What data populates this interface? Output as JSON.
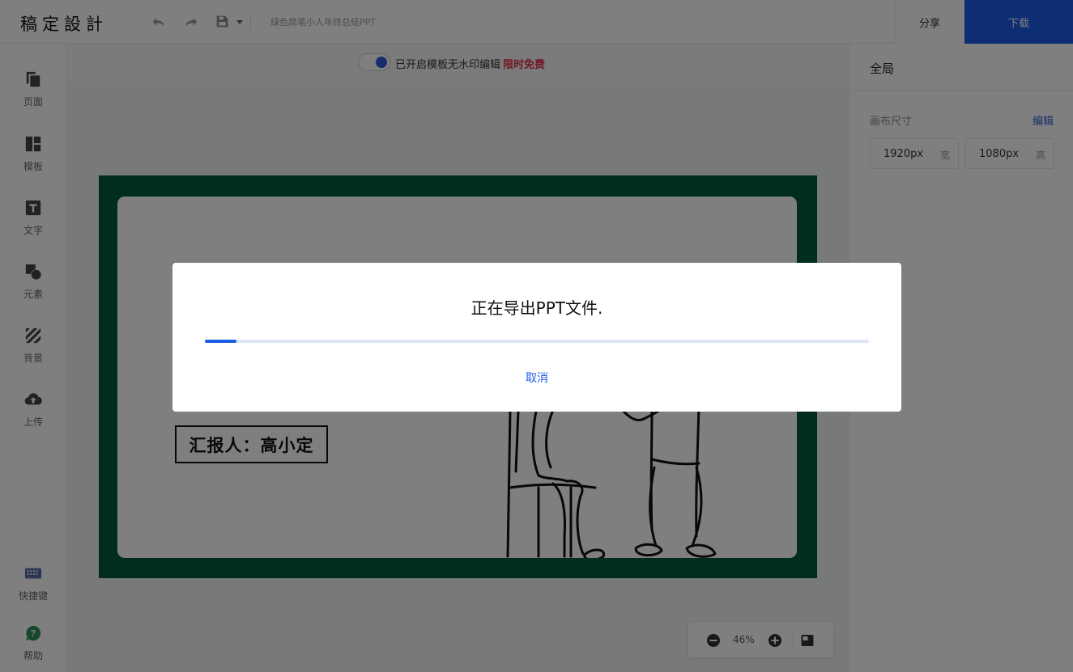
{
  "app": {
    "logo": "稿定設計",
    "doc_title": "绿色简笔小人年终总结PPT"
  },
  "header": {
    "share_label": "分享",
    "download_label": "下载"
  },
  "sidebar": {
    "items": [
      {
        "label": "页面",
        "icon": "pages-icon"
      },
      {
        "label": "模板",
        "icon": "template-icon"
      },
      {
        "label": "文字",
        "icon": "text-icon"
      },
      {
        "label": "元素",
        "icon": "element-icon"
      },
      {
        "label": "背景",
        "icon": "background-icon"
      },
      {
        "label": "上传",
        "icon": "upload-icon"
      }
    ],
    "bottom": [
      {
        "label": "快捷键",
        "icon": "keyboard-icon"
      },
      {
        "label": "帮助",
        "icon": "help-icon"
      }
    ]
  },
  "canvas": {
    "watermark_text": "已开启模板无水印编辑",
    "watermark_free": "限时免费",
    "slide_reporter": "汇报人：高小定",
    "zoom": "46%"
  },
  "right_panel": {
    "title": "全局",
    "canvas_size_label": "画布尺寸",
    "edit_label": "编辑",
    "width_value": "1920px",
    "width_unit": "宽",
    "height_value": "1080px",
    "height_unit": "高"
  },
  "modal": {
    "title": "正在导出PPT文件.",
    "cancel_label": "取消",
    "progress": 0.047
  },
  "colors": {
    "accent": "#1a5ce6",
    "slide_border": "#005a3a",
    "free_red": "#e0304a"
  }
}
